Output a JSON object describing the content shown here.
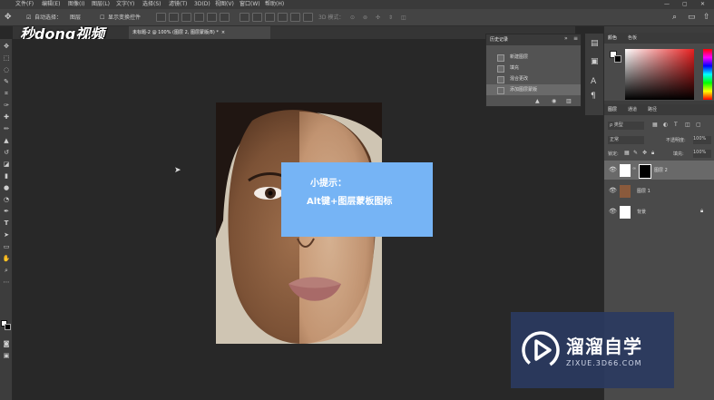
{
  "menu": {
    "items": [
      "文件(F)",
      "编辑(E)",
      "图像(I)",
      "图层(L)",
      "文字(Y)",
      "选择(S)",
      "滤镜(T)",
      "3D(D)",
      "视图(V)",
      "窗口(W)",
      "帮助(H)"
    ]
  },
  "options": {
    "auto_select_label": "自动选择：",
    "auto_select_value": "图层",
    "show_transform_label": "显示变换控件",
    "mode_3d_label": "3D 模式："
  },
  "logo": {
    "text": "秒dong视频"
  },
  "tabs": [
    {
      "label": "未标题-2 @ 100% (图层 2, 图层蒙版/8) *"
    }
  ],
  "tooltip": {
    "title": "小提示：",
    "body": "Alt键+图层蒙板图标",
    "color": "#76b4f5"
  },
  "history_panel": {
    "title": "历史记录",
    "items": [
      "新建图层",
      "填充",
      "混合更改",
      "添加图层蒙版"
    ]
  },
  "color_panel": {
    "tabs": [
      "颜色",
      "色板"
    ]
  },
  "layers_panel": {
    "tabs": [
      "图层",
      "通道",
      "路径"
    ],
    "kind_filter": "ρ 类型",
    "blend_mode": "正常",
    "opacity_label": "不透明度:",
    "opacity_value": "100%",
    "lock_label": "锁定:",
    "fill_label": "填充:",
    "fill_value": "100%",
    "layers": [
      {
        "name": "图层 2",
        "selected": true
      },
      {
        "name": "图层 1",
        "selected": false
      },
      {
        "name": "背景",
        "selected": false
      }
    ]
  },
  "watermark": {
    "name": "溜溜自学",
    "url": "ZIXUE.3D66.COM"
  },
  "colors": {
    "accent": "#76b4f5"
  }
}
